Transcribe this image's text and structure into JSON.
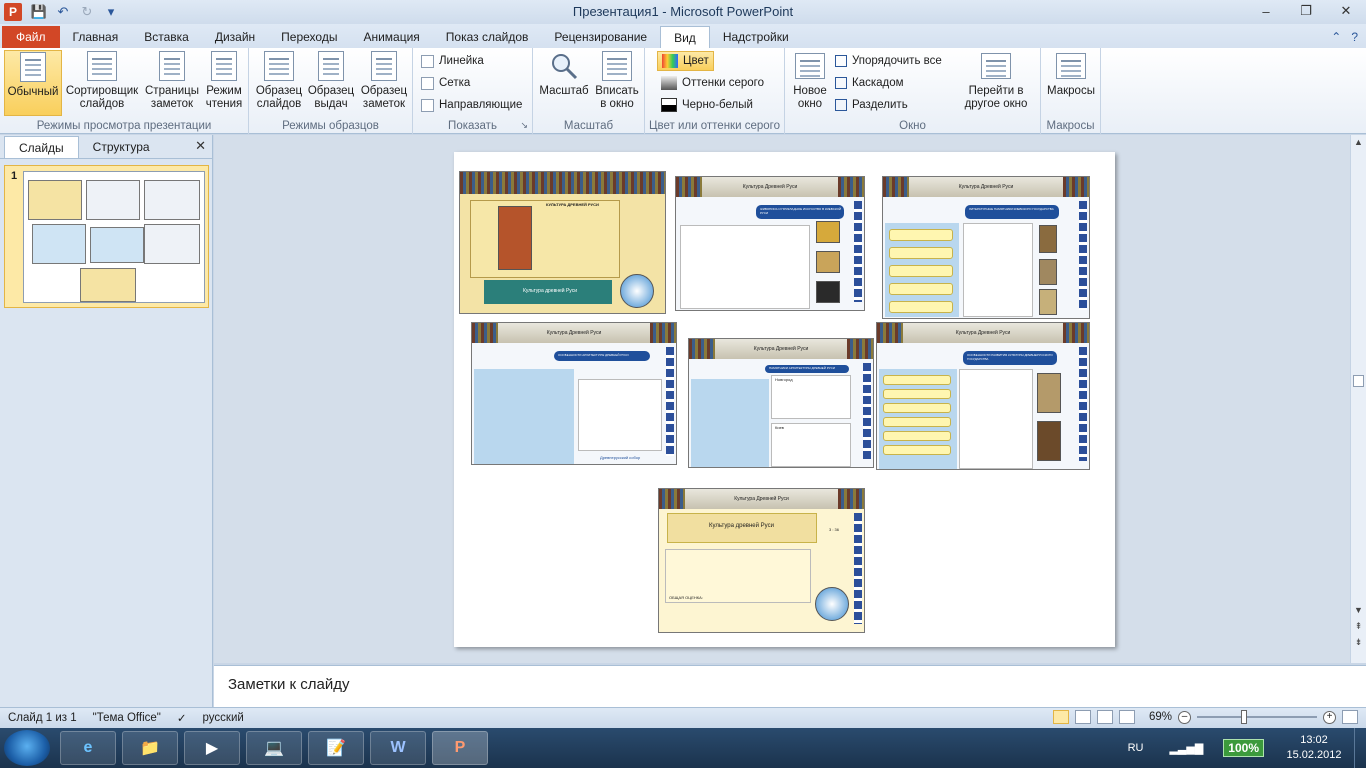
{
  "window": {
    "title": "Презентация1  -  Microsoft PowerPoint",
    "app_icon_letter": "P",
    "controls": {
      "minimize": "–",
      "maximize": "❐",
      "close": "✕"
    }
  },
  "quick_access": {
    "save_icon": "💾",
    "undo_icon": "↶",
    "redo_icon": "↻",
    "customize_icon": "▾"
  },
  "tabs": {
    "file": "Файл",
    "items": [
      "Главная",
      "Вставка",
      "Дизайн",
      "Переходы",
      "Анимация",
      "Показ слайдов",
      "Рецензирование",
      "Вид",
      "Надстройки"
    ],
    "active": "Вид",
    "collapse_icon": "⌃",
    "help_icon": "?"
  },
  "ribbon": {
    "presentation_views": {
      "label": "Режимы просмотра презентации",
      "normal": "Обычный",
      "sorter": "Сортировщик слайдов",
      "notes_page": "Страницы заметок",
      "reading": "Режим чтения"
    },
    "master_views": {
      "label": "Режимы образцов",
      "slide_master": "Образец слайдов",
      "handout_master": "Образец выдач",
      "notes_master": "Образец заметок"
    },
    "show": {
      "label": "Показать",
      "ruler": "Линейка",
      "gridlines": "Сетка",
      "guides": "Направляющие",
      "launcher": "↘"
    },
    "zoom": {
      "label": "Масштаб",
      "zoom": "Масштаб",
      "fit": "Вписать в окно"
    },
    "color": {
      "label": "Цвет или оттенки серого",
      "color": "Цвет",
      "grayscale": "Оттенки серого",
      "bw": "Черно-белый"
    },
    "window": {
      "label": "Окно",
      "new_window": "Новое окно",
      "arrange_all": "Упорядочить все",
      "cascade": "Каскадом",
      "split": "Разделить",
      "switch": "Перейти в другое окно"
    },
    "macros": {
      "label": "Макросы",
      "macros": "Макросы"
    }
  },
  "left_pane": {
    "tab_slides": "Слайды",
    "tab_outline": "Структура",
    "close_icon": "✕",
    "slide_number": "1"
  },
  "slide_content": {
    "title_main": "Культура Древней Руси",
    "banner": "Культура древней Руси",
    "heading_cultures": "КУЛЬТУРА ДРЕВНЕЙ РУСИ",
    "heading_painting": "ЖИВОПИСЬ И ПРИКЛАДНОЕ ИСКУССТВО В КИЕВСКОЙ РУСИ",
    "heading_literature": "ЛИТЕРАТУРНЫЕ ПАМЯТНИКИ КИЕВСКОГО ГОСУДАРСТВА",
    "heading_architecture": "ОСОБЕННОСТИ АРХИТЕКТУРЫ ДРЕВНЕЙ РУСИ",
    "heading_monuments": "ПАМЯТНИКИ АРХИТЕКТУРЫ ДРЕВНЕЙ РУСИ",
    "heading_development": "ОСОБЕННОСТИ РАЗВИТИЯ КУЛЬТУРЫ ДРЕВНЕРУССКОГО ГОСУДАРСТВА",
    "label_novgorod": "Новгород",
    "label_kiev": "Киев",
    "label_cathedral": "Древнерусский собор",
    "score_label": "ОБЩАЯ ОЦЕНКА:",
    "score_ratio": "3 : 36"
  },
  "notes": {
    "placeholder": "Заметки к слайду"
  },
  "status": {
    "slide": "Слайд 1 из 1",
    "theme": "\"Тема Office\"",
    "language": "русский",
    "zoom": "69%"
  },
  "taskbar": {
    "apps": [
      "e",
      "📁",
      "▶",
      "💻",
      "📝",
      "W",
      "P"
    ],
    "lang": "RU",
    "battery": "100%",
    "time": "13:02",
    "date": "15.02.2012"
  }
}
